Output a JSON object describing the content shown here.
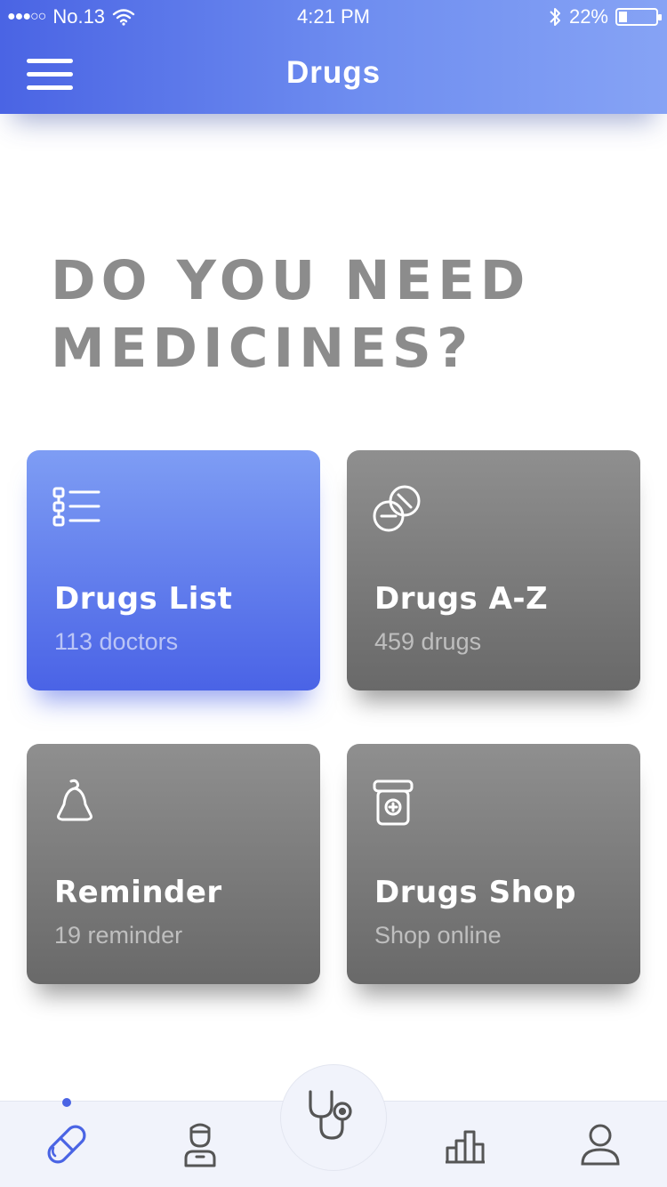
{
  "status_bar": {
    "signal_dots": "●●●○○",
    "carrier": "No.13",
    "time": "4:21 PM",
    "battery_percent": "22%",
    "battery_level": 0.22
  },
  "header": {
    "title": "Drugs",
    "menu_icon": "hamburger-menu-icon",
    "gradient": [
      "#4a64e4",
      "#86a3f5"
    ]
  },
  "hero": {
    "line1": "DO YOU NEED",
    "line2": "MEDICINES?"
  },
  "cards": [
    {
      "title": "Drugs List",
      "subtitle": "113 doctors",
      "icon": "checklist-icon",
      "active": true
    },
    {
      "title": "Drugs A-Z",
      "subtitle": "459 drugs",
      "icon": "pills-icon",
      "active": false
    },
    {
      "title": "Reminder",
      "subtitle": "19 reminder",
      "icon": "bell-icon",
      "active": false
    },
    {
      "title": "Drugs Shop",
      "subtitle": "Shop online",
      "icon": "medicine-bottle-icon",
      "active": false
    }
  ],
  "tabbar": {
    "items": [
      {
        "name": "drugs",
        "icon": "pill-icon",
        "active": true
      },
      {
        "name": "doctors",
        "icon": "doctor-icon",
        "active": false
      },
      {
        "name": "checkup",
        "icon": "stethoscope-icon",
        "active": false
      },
      {
        "name": "stats",
        "icon": "bar-chart-icon",
        "active": false
      },
      {
        "name": "profile",
        "icon": "user-icon",
        "active": false
      }
    ]
  },
  "colors": {
    "accent": "#4a64e4",
    "card_gray": "#7c7c7c",
    "hero_text": "#8c8c8c",
    "tab_inactive": "#555555"
  }
}
